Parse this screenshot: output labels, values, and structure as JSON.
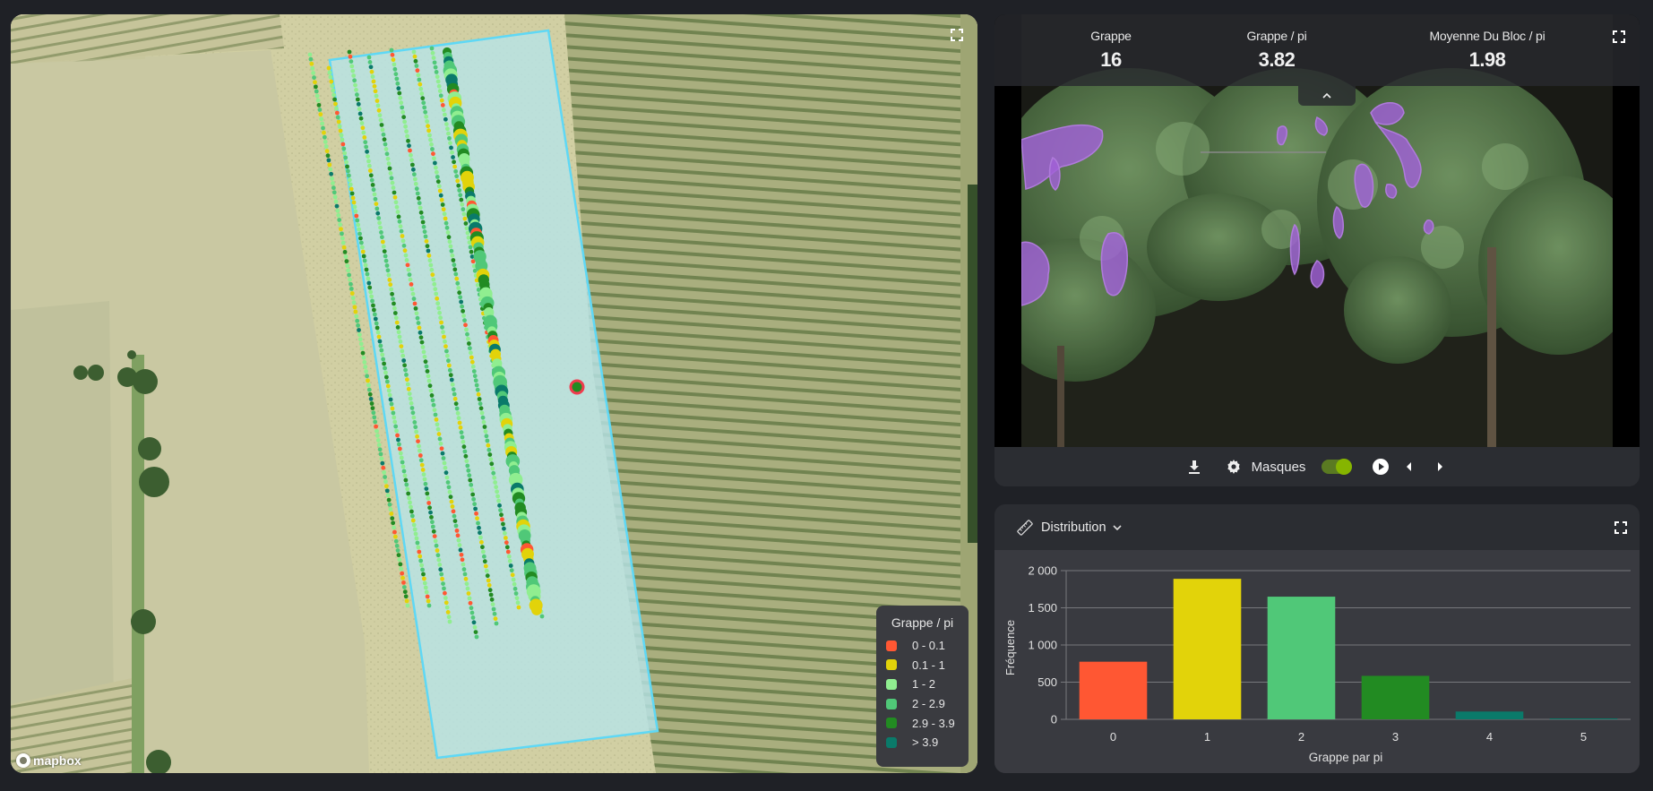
{
  "map": {
    "attribution": "mapbox",
    "legend": {
      "title": "Grappe / pi",
      "items": [
        {
          "label": "0 - 0.1",
          "color": "#ff5733"
        },
        {
          "label": "0.1 - 1",
          "color": "#e2d30a"
        },
        {
          "label": "1 - 2",
          "color": "#90ee90"
        },
        {
          "label": "2 - 2.9",
          "color": "#50c878"
        },
        {
          "label": "2.9 - 3.9",
          "color": "#228b22"
        },
        {
          "label": "> 3.9",
          "color": "#0a7a6a"
        }
      ]
    },
    "polygon_color": "#5fd8f5",
    "selected_marker_color": "#f03b4e",
    "icons": {
      "fullscreen": "fullscreen-icon",
      "logo": "mapbox-logo-icon"
    }
  },
  "photo_panel": {
    "stats": [
      {
        "label": "Grappe",
        "value": "16"
      },
      {
        "label": "Grappe / pi",
        "value": "3.82"
      },
      {
        "label": "Moyenne Du Bloc / pi",
        "value": "1.98"
      }
    ],
    "toolbar": {
      "masks_label": "Masques",
      "masks_enabled": true,
      "icons": [
        "download-icon",
        "gear-icon",
        "play-icon",
        "chevron-left-icon",
        "chevron-right-icon"
      ]
    },
    "mask_color": "#b36cf0"
  },
  "distribution_panel": {
    "title": "Distribution",
    "icons": {
      "title": "ruler-icon",
      "dropdown": "chevron-down-icon",
      "fullscreen": "fullscreen-icon"
    }
  },
  "chart_data": {
    "type": "bar",
    "title": "",
    "xlabel": "Grappe par pi",
    "ylabel": "Fréquence",
    "categories": [
      "0",
      "1",
      "2",
      "3",
      "4",
      "5"
    ],
    "values": [
      775,
      1890,
      1650,
      585,
      105,
      12
    ],
    "colors": [
      "#ff5733",
      "#e2d30a",
      "#50c878",
      "#228b22",
      "#0a7a6a",
      "#0a7a6a"
    ],
    "ylim": [
      0,
      2000
    ],
    "yticks": [
      0,
      500,
      1000,
      1500,
      2000
    ],
    "ytick_labels": [
      "0",
      "500",
      "1 000",
      "1 500",
      "2 000"
    ],
    "grid": true,
    "legend": "none"
  }
}
